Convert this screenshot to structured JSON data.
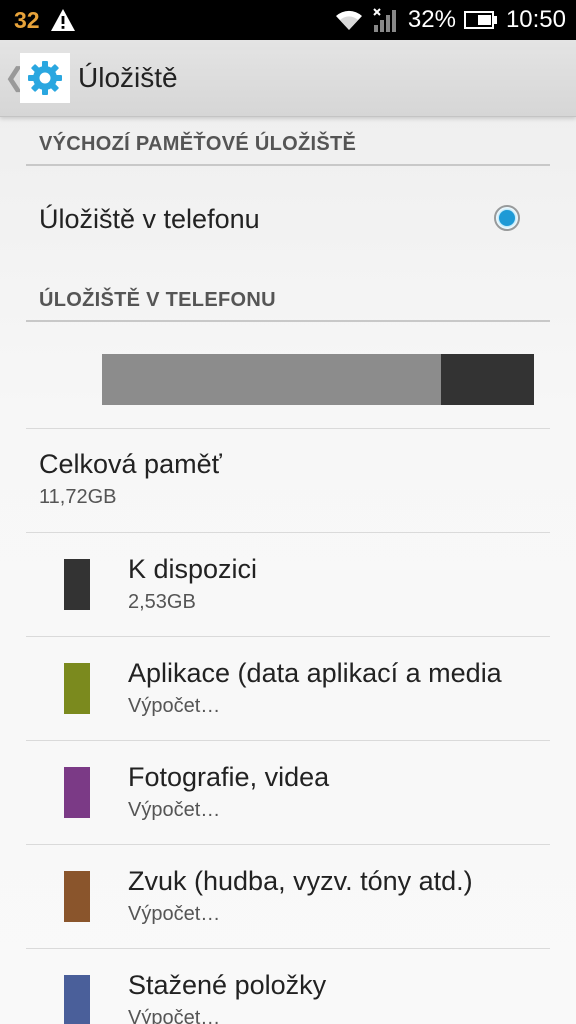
{
  "status_bar": {
    "notification_count": "32",
    "battery_percent": "32%",
    "time": "10:50",
    "icons": [
      "warning-icon",
      "wifi-icon",
      "signal-icon",
      "battery-icon"
    ]
  },
  "action_bar": {
    "back_glyph": "❮",
    "icon": "settings-gear-icon",
    "title": "Úložiště"
  },
  "default_storage": {
    "header": "VÝCHOZÍ PAMĚŤOVÉ ÚLOŽIŠTĚ",
    "option_label": "Úložiště v telefonu",
    "selected": true
  },
  "phone_storage": {
    "header": "ÚLOŽIŠTĚ V TELEFONU",
    "usage_bar": {
      "used_color": "#8c8c8c",
      "free_color": "#333333",
      "free_fraction": 0.216
    },
    "total": {
      "title": "Celková paměť",
      "value": "11,72GB"
    },
    "categories": [
      {
        "title": "K dispozici",
        "value": "2,53GB",
        "color": "#333333"
      },
      {
        "title": "Aplikace (data aplikací a media",
        "value": "Výpočet…",
        "color": "#7b8a1e"
      },
      {
        "title": "Fotografie, videa",
        "value": "Výpočet…",
        "color": "#7b3a86"
      },
      {
        "title": "Zvuk (hudba, vyzv. tóny atd.)",
        "value": "Výpočet…",
        "color": "#8a552c"
      },
      {
        "title": "Stažené položky",
        "value": "Výpočet…",
        "color": "#4a5f9a"
      }
    ]
  },
  "colors": {
    "accent": "#1e9ad6",
    "status_bar_bg": "#000000",
    "notification_count": "#e8a33a"
  }
}
